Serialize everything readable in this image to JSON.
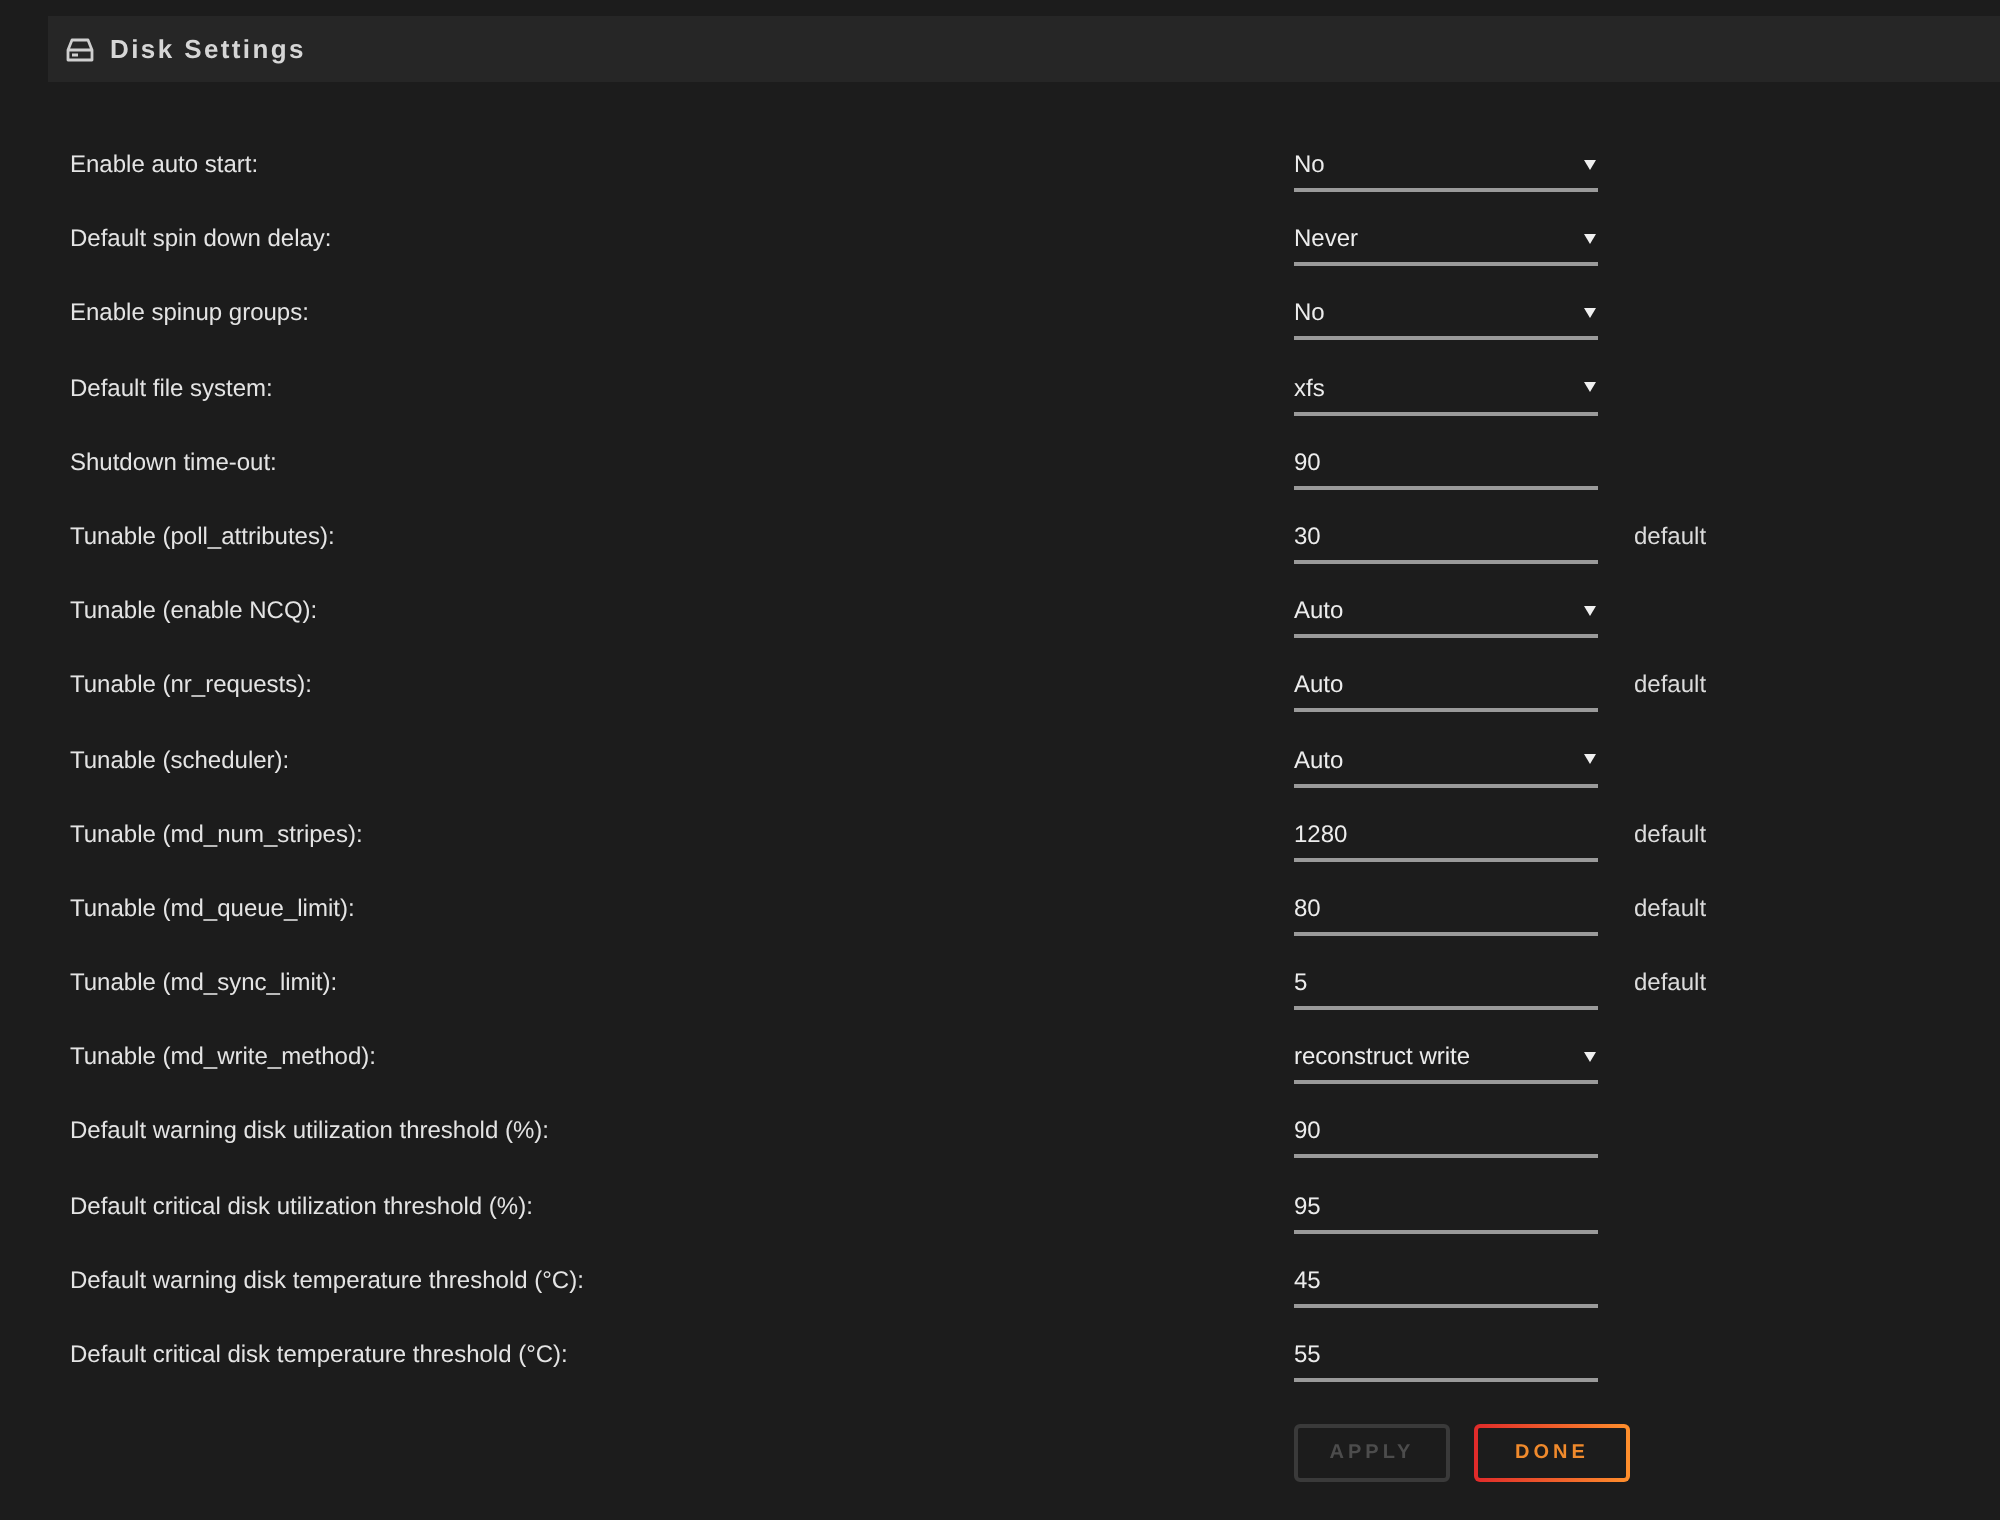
{
  "panel": {
    "title": "Disk Settings"
  },
  "settings": [
    {
      "label": "Enable auto start:",
      "kind": "select",
      "value": "No"
    },
    {
      "label": "Default spin down delay:",
      "kind": "select",
      "value": "Never"
    },
    {
      "label": "Enable spinup groups:",
      "kind": "select",
      "value": "No"
    },
    {
      "label": "Default file system:",
      "kind": "select",
      "value": "xfs"
    },
    {
      "label": "Shutdown time-out:",
      "kind": "input",
      "value": "90"
    },
    {
      "label": "Tunable (poll_attributes):",
      "kind": "input",
      "value": "30",
      "note": "default"
    },
    {
      "label": "Tunable (enable NCQ):",
      "kind": "select",
      "value": "Auto"
    },
    {
      "label": "Tunable (nr_requests):",
      "kind": "input",
      "value": "Auto",
      "note": "default"
    },
    {
      "label": "Tunable (scheduler):",
      "kind": "select",
      "value": "Auto"
    },
    {
      "label": "Tunable (md_num_stripes):",
      "kind": "input",
      "value": "1280",
      "note": "default"
    },
    {
      "label": "Tunable (md_queue_limit):",
      "kind": "input",
      "value": "80",
      "note": "default"
    },
    {
      "label": "Tunable (md_sync_limit):",
      "kind": "input",
      "value": "5",
      "note": "default"
    },
    {
      "label": "Tunable (md_write_method):",
      "kind": "select",
      "value": "reconstruct write"
    },
    {
      "label": "Default warning disk utilization threshold (%):",
      "kind": "input",
      "value": "90"
    },
    {
      "label": "Default critical disk utilization threshold (%):",
      "kind": "input",
      "value": "95"
    },
    {
      "label": "Default warning disk temperature threshold (°C):",
      "kind": "input",
      "value": "45"
    },
    {
      "label": "Default critical disk temperature threshold (°C):",
      "kind": "input",
      "value": "55"
    }
  ],
  "buttons": [
    {
      "label": "APPLY",
      "kind": "secondary",
      "disabled": true
    },
    {
      "label": "DONE",
      "kind": "primary",
      "disabled": false
    }
  ]
}
